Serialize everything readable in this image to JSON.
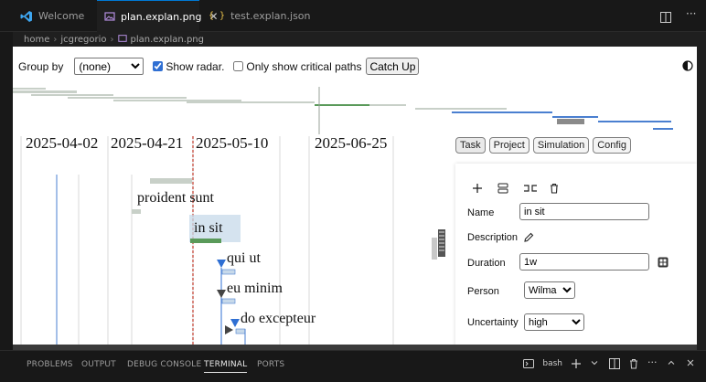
{
  "tabs": [
    {
      "label": "Welcome",
      "active": false,
      "icon": "vscode-logo-icon"
    },
    {
      "label": "plan.explan.png",
      "active": true,
      "icon": "image-file-icon"
    },
    {
      "label": "test.explan.json",
      "active": false,
      "icon": "json-braces-icon"
    }
  ],
  "breadcrumb": {
    "items": [
      "home",
      "jcgregorio",
      "plan.explan.png"
    ]
  },
  "toolbar": {
    "group_by_label": "Group by",
    "group_by_value": "(none)",
    "show_radar_label": "Show radar.",
    "show_radar_checked": true,
    "critical_paths_label": "Only show critical paths",
    "critical_paths_checked": false,
    "catch_up_label": "Catch Up"
  },
  "timeline": {
    "dates": [
      "2025-04-02",
      "2025-04-21",
      "2025-05-10",
      "2025-06-25"
    ]
  },
  "tasks": [
    {
      "name": "proident sunt"
    },
    {
      "name": "in sit",
      "selected": true
    },
    {
      "name": "qui ut"
    },
    {
      "name": "eu minim"
    },
    {
      "name": "do excepteur"
    },
    {
      "name": "..."
    }
  ],
  "side_tabs": [
    "Task",
    "Project",
    "Simulation",
    "Config"
  ],
  "active_side_tab": "Task",
  "task_form": {
    "name_label": "Name",
    "name_value": "in sit",
    "description_label": "Description",
    "duration_label": "Duration",
    "duration_value": "1w",
    "person_label": "Person",
    "person_value": "Wilma",
    "uncertainty_label": "Uncertainty",
    "uncertainty_value": "high"
  },
  "bottom_panel": {
    "tabs": [
      "PROBLEMS",
      "OUTPUT",
      "DEBUG CONSOLE",
      "TERMINAL",
      "PORTS"
    ],
    "active": "TERMINAL",
    "terminal_name": "bash"
  },
  "colors": {
    "accent": "#0078d4",
    "critical": "#c0392b",
    "progress": "#5a9a5a",
    "radar_blue": "#4a7fd0",
    "milestone": "#2f6fd3"
  }
}
